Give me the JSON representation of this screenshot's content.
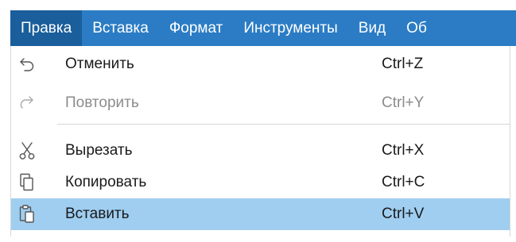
{
  "menubar": {
    "items": [
      {
        "label": "Правка",
        "active": true
      },
      {
        "label": "Вставка",
        "active": false
      },
      {
        "label": "Формат",
        "active": false
      },
      {
        "label": "Инструменты",
        "active": false
      },
      {
        "label": "Вид",
        "active": false
      },
      {
        "label": "Об",
        "active": false
      }
    ],
    "bg_color": "#2b7cc4",
    "active_color": "#1a5e9c"
  },
  "menu": {
    "undo": {
      "label": "Отменить",
      "shortcut": "Ctrl+Z",
      "icon": "undo-icon",
      "enabled": true
    },
    "redo": {
      "label": "Повторить",
      "shortcut": "Ctrl+Y",
      "icon": "redo-icon",
      "enabled": false
    },
    "cut": {
      "label": "Вырезать",
      "shortcut": "Ctrl+X",
      "icon": "scissors-icon",
      "enabled": true
    },
    "copy": {
      "label": "Копировать",
      "shortcut": "Ctrl+C",
      "icon": "copy-icon",
      "enabled": true
    },
    "paste": {
      "label": "Вставить",
      "shortcut": "Ctrl+V",
      "icon": "clipboard-paste-icon",
      "enabled": true,
      "highlighted": true
    }
  },
  "colors": {
    "highlight": "#9fcef1",
    "text": "#1a1a1a",
    "disabled_text": "#8c8c8c"
  }
}
